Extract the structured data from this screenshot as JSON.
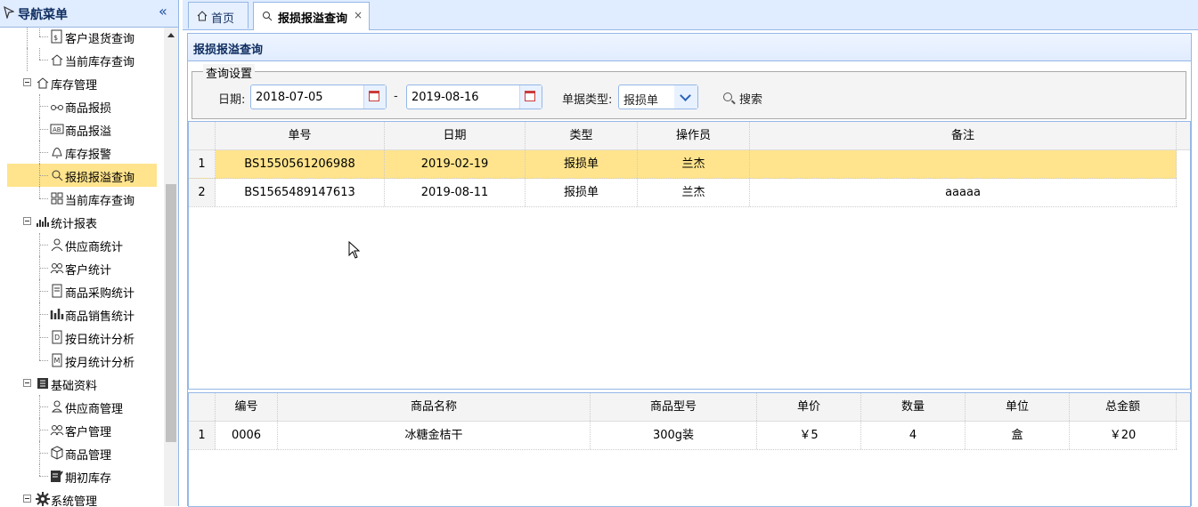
{
  "sidebar": {
    "title": "导航菜单",
    "collapse_glyph": "«",
    "items": [
      {
        "label": "客户退货查询",
        "icon": "return-query-icon"
      },
      {
        "label": "当前库存查询",
        "icon": "house-icon"
      },
      {
        "label": "库存管理",
        "icon": "house-icon"
      },
      {
        "label": "商品报损",
        "icon": "glasses-icon"
      },
      {
        "label": "商品报溢",
        "icon": "ab-box-icon"
      },
      {
        "label": "库存报警",
        "icon": "bell-icon"
      },
      {
        "label": "报损报溢查询",
        "icon": "search-icon"
      },
      {
        "label": "当前库存查询",
        "icon": "grid-icon"
      },
      {
        "label": "统计报表",
        "icon": "bar-chart-icon"
      },
      {
        "label": "供应商统计",
        "icon": "person-icon"
      },
      {
        "label": "客户统计",
        "icon": "people-icon"
      },
      {
        "label": "商品采购统计",
        "icon": "document-icon"
      },
      {
        "label": "商品销售统计",
        "icon": "bar-chart-icon"
      },
      {
        "label": "按日统计分析",
        "icon": "day-icon"
      },
      {
        "label": "按月统计分析",
        "icon": "month-icon"
      },
      {
        "label": "基础资料",
        "icon": "book-icon"
      },
      {
        "label": "供应商管理",
        "icon": "supplier-icon"
      },
      {
        "label": "客户管理",
        "icon": "people-icon"
      },
      {
        "label": "商品管理",
        "icon": "cube-icon"
      },
      {
        "label": "期初库存",
        "icon": "edit-icon"
      },
      {
        "label": "系统管理",
        "icon": "gear-icon"
      }
    ]
  },
  "tabs": [
    {
      "label": "首页",
      "icon": "home-icon"
    },
    {
      "label": "报损报溢查询",
      "icon": "search-icon",
      "close": "×"
    }
  ],
  "panel": {
    "title": "报损报溢查询",
    "query": {
      "legend": "查询设置",
      "date_label": "日期:",
      "date_from": "2018-07-05",
      "separator": "-",
      "date_to": "2019-08-16",
      "type_label": "单据类型:",
      "type_value": "报损单",
      "search_label": "搜索"
    },
    "upper_grid": {
      "columns": [
        "单号",
        "日期",
        "类型",
        "操作员",
        "备注"
      ],
      "rows": [
        {
          "rn": "1",
          "cells": [
            "BS1550561206988",
            "2019-02-19",
            "报损单",
            "兰杰",
            ""
          ]
        },
        {
          "rn": "2",
          "cells": [
            "BS1565489147613",
            "2019-08-11",
            "报损单",
            "兰杰",
            "aaaaa"
          ]
        }
      ]
    },
    "lower_grid": {
      "columns": [
        "编号",
        "商品名称",
        "商品型号",
        "单价",
        "数量",
        "单位",
        "总金额"
      ],
      "rows": [
        {
          "rn": "1",
          "cells": [
            "0006",
            "冰糖金桔干",
            "300g装",
            "￥5",
            "4",
            "盒",
            "￥20"
          ]
        }
      ]
    }
  },
  "colors": {
    "accent": "#95b8e7",
    "header_bg": "#e0ecff",
    "selected_row": "#ffe48d"
  }
}
